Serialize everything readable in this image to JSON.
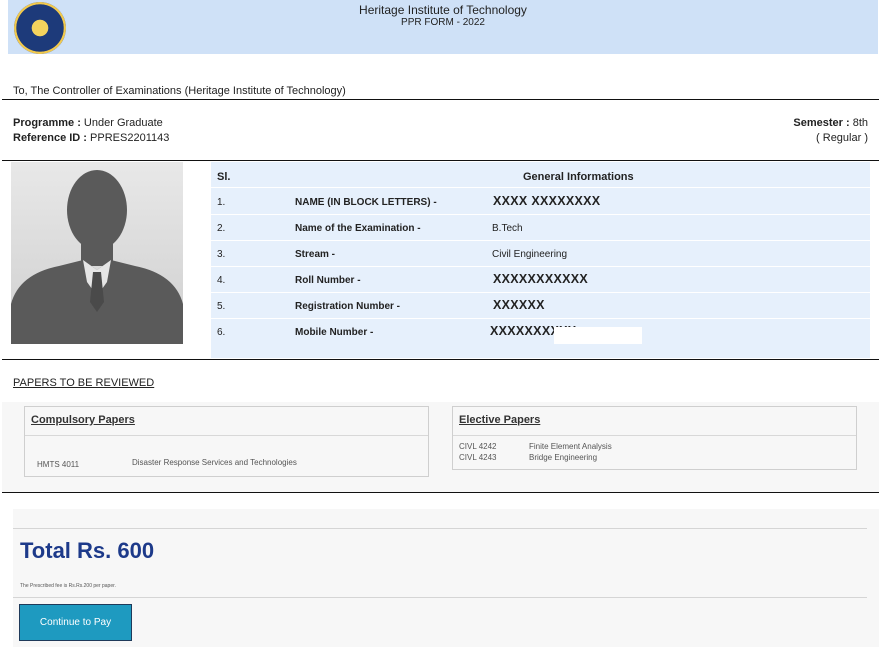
{
  "header": {
    "institute": "Heritage Institute of Technology",
    "form_title": "PPR FORM - 2022",
    "logo_icon": "institute-seal-icon"
  },
  "address_line": "To, The Controller of Examinations (Heritage Institute of Technology)",
  "meta": {
    "programme_label": "Programme :",
    "programme_value": "Under Graduate",
    "reference_label": "Reference ID :",
    "reference_value": "PPRES2201143",
    "semester_label": "Semester :",
    "semester_value": "8th",
    "semester_type": "( Regular )"
  },
  "photo_icon": "user-silhouette-icon",
  "general_info": {
    "col_sl": "Sl.",
    "col_title": "General Informations",
    "rows": [
      {
        "sl": "1.",
        "label": "NAME (IN BLOCK LETTERS) -",
        "value": "XXXX XXXXXXXX"
      },
      {
        "sl": "2.",
        "label": "Name of the Examination -",
        "value": "B.Tech"
      },
      {
        "sl": "3.",
        "label": "Stream -",
        "value": "Civil Engineering"
      },
      {
        "sl": "4.",
        "label": "Roll Number -",
        "value": "XXXXXXXXXXX"
      },
      {
        "sl": "5.",
        "label": "Registration Number -",
        "value": "XXXXXX"
      },
      {
        "sl": "6.",
        "label": "Mobile Number -",
        "value": "XXXXXXXXXX"
      }
    ]
  },
  "papers": {
    "heading": "PAPERS TO BE REVIEWED",
    "compulsory": {
      "title": "Compulsory Papers",
      "items": [
        {
          "code": "HMTS 4011",
          "name": "Disaster Response Services and Technologies"
        }
      ]
    },
    "elective": {
      "title": "Elective Papers",
      "items": [
        {
          "code": "CIVL 4242",
          "name": "Finite Element Analysis"
        },
        {
          "code": "CIVL 4243",
          "name": "Bridge Engineering"
        }
      ]
    }
  },
  "payment": {
    "total": "Total Rs. 600",
    "fee_note": "The Prescribed fee is Rs.Rs.200 per paper.",
    "pay_button": "Continue to Pay"
  },
  "colors": {
    "header_bg": "#cfe1f7",
    "info_bg": "#e6f0fc",
    "total_text": "#1d3a8a",
    "pay_button_bg": "#1e9ac0"
  }
}
